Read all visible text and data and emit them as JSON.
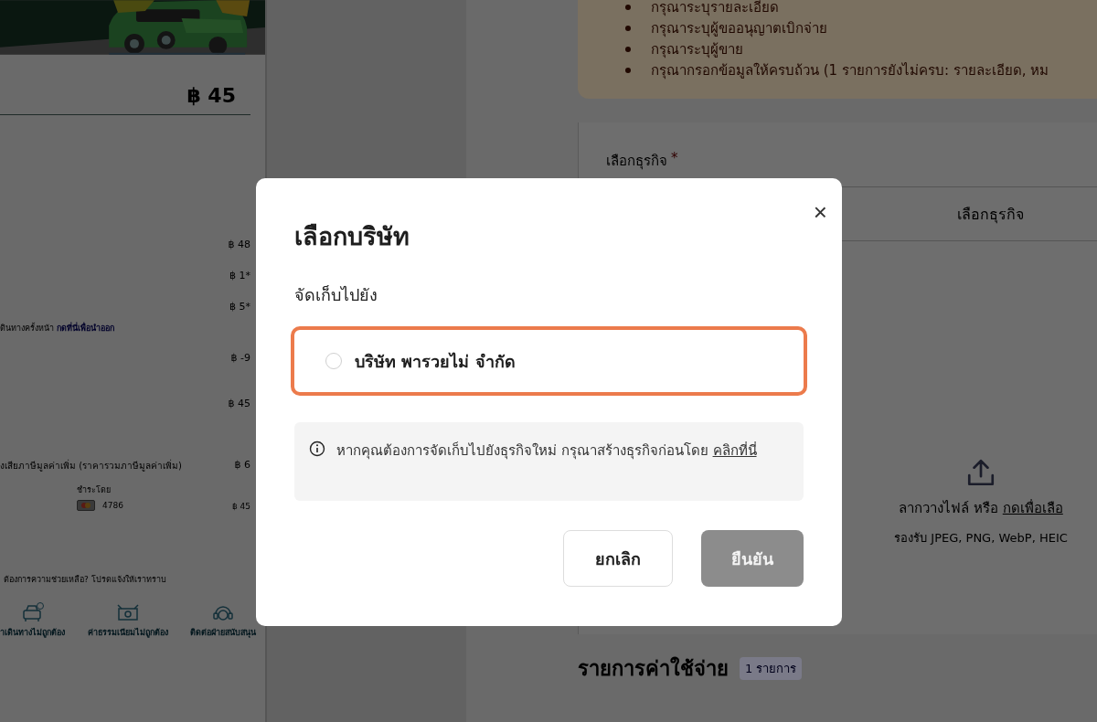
{
  "trip_panel": {
    "total": "฿ 45",
    "fare_rows": [
      {
        "amount": "฿ 48"
      },
      {
        "amount": "฿ 1*"
      },
      {
        "amount": "฿ 5*"
      }
    ],
    "note": {
      "text": "ดินทางครั้งหน้า",
      "link": "กดที่นี่เพื่อนำออก"
    },
    "discount_rows": [
      {
        "amount": "฿ -9"
      },
      {
        "amount": "฿ 45"
      }
    ],
    "vat_row": {
      "label": "งเสียภาษีมูลค่าเพิ่ม (ราคารวมภาษีมูลค่าเพิ่ม)",
      "amount": "฿ 6"
    },
    "payment": {
      "label": "ชำระโดย",
      "card": "4786",
      "amount": "฿ 45"
    },
    "help": {
      "title": "ต้องการความช่วยเหลือ? โปรดแจ้งให้เราทราบ",
      "items": [
        {
          "kind": "car",
          "label": "าเดินทางไม่ถูกต้อง"
        },
        {
          "kind": "money",
          "label": "ค่าธรรมเนียมไม่ถูกต้อง"
        },
        {
          "kind": "support",
          "label": "ติดต่อฝ่ายสนับสนุน"
        }
      ]
    }
  },
  "expense_form": {
    "alerts": [
      "กรุณาระบุรายละเอียด",
      "กรุณาระบุผู้ขออนุญาตเบิกจ่าย",
      "กรุณาระบุผู้ขาย",
      "กรุณากรอกข้อมูลให้ครบถ้วน (1 รายการยังไม่ครบ: รายละเอียด, หม"
    ],
    "business_label": "เลือกธุรกิจ",
    "required_mark": "*",
    "business_placeholder": "เลือกธุรกิจ",
    "upload": {
      "text": "ลากวางไฟล์ หรือ ",
      "link": "กดเพื่อเลือ",
      "formats": "รองรับ JPEG, PNG, WebP, HEIC"
    },
    "expenses_title": "รายการค่าใช้จ่าย",
    "expenses_count": "1 รายการ"
  },
  "dialog": {
    "title": "เลือกบริษัท",
    "close": "×",
    "section_label": "จัดเก็บไปยัง",
    "options": [
      {
        "label": "บริษัท พารวยไม่ จำกัด",
        "selected": false,
        "highlighted": true
      }
    ],
    "info": {
      "text": "หากคุณต้องการจัดเก็บไปยังธุรกิจใหม่ กรุณาสร้างธุรกิจก่อนโดย",
      "link": "คลิกที่นี่"
    },
    "buttons": [
      {
        "kind": "secondary",
        "label": "ยกเลิก",
        "disabled": false
      },
      {
        "kind": "primary",
        "label": "ยืนยัน",
        "disabled": true
      }
    ]
  }
}
